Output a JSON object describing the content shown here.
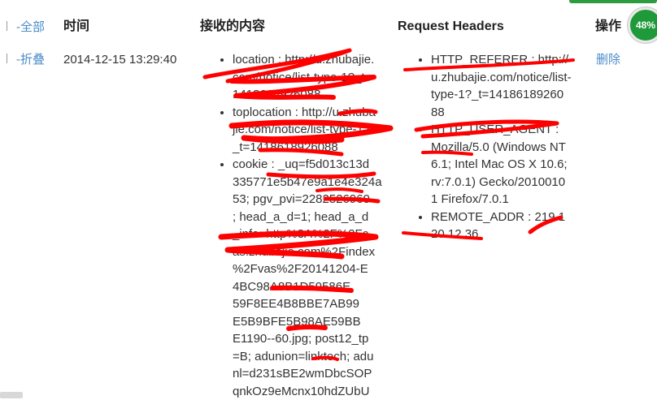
{
  "header": {
    "select_all": "-全部",
    "time": "时间",
    "content": "接收的内容",
    "headers": "Request Headers",
    "actions": "操作"
  },
  "row": {
    "collapse": "-折叠",
    "time": "2014-12-15 13:29:40",
    "content_lines": [
      "location : http://u.zhubajie.",
      "com/notice/list-type-1?_t=",
      "1418618926088",
      "toplocation : http://u.zhuba",
      "jie.com/notice/list-type-1?",
      "_t=1418618926088",
      "cookie : _uq=f5d013c13d",
      "335771e5b47e9a1e4e324a",
      "53; pgv_pvi=2282526960",
      "; head_a_d=1; head_a_d",
      "_info=http%3A%2F%2Fc",
      "as.zhubajie.com%2Findex",
      "%2Fvas%2F20141204-E",
      "4BC98A8B1D59586E",
      "59F8EE4B8BBE7AB99",
      "E5B9BFE5B98AE59BB",
      "E1190--60.jpg; post12_tp",
      "=B; adunion=linktech; adu",
      "nl=d231sBE2wmDbcSOP",
      "qnkOz9eMcnx10hdZUbU"
    ],
    "header_lines": [
      "HTTP_REFERER : http://",
      "u.zhubajie.com/notice/list-",
      "type-1?_t=14186189260",
      "88",
      "HTTP_USER_AGENT :",
      "Mozilla/5.0 (Windows NT",
      "6.1; Intel Mac OS X 10.6;",
      "rv:7.0.1) Gecko/2010010",
      "1 Firefox/7.0.1",
      "REMOTE_ADDR : 219.1",
      "20.12.36"
    ],
    "delete": "删除"
  },
  "badge": "48%",
  "colors": {
    "link": "#4a8cc8",
    "scribble": "#ff0000",
    "badge": "#1f9a3a"
  }
}
